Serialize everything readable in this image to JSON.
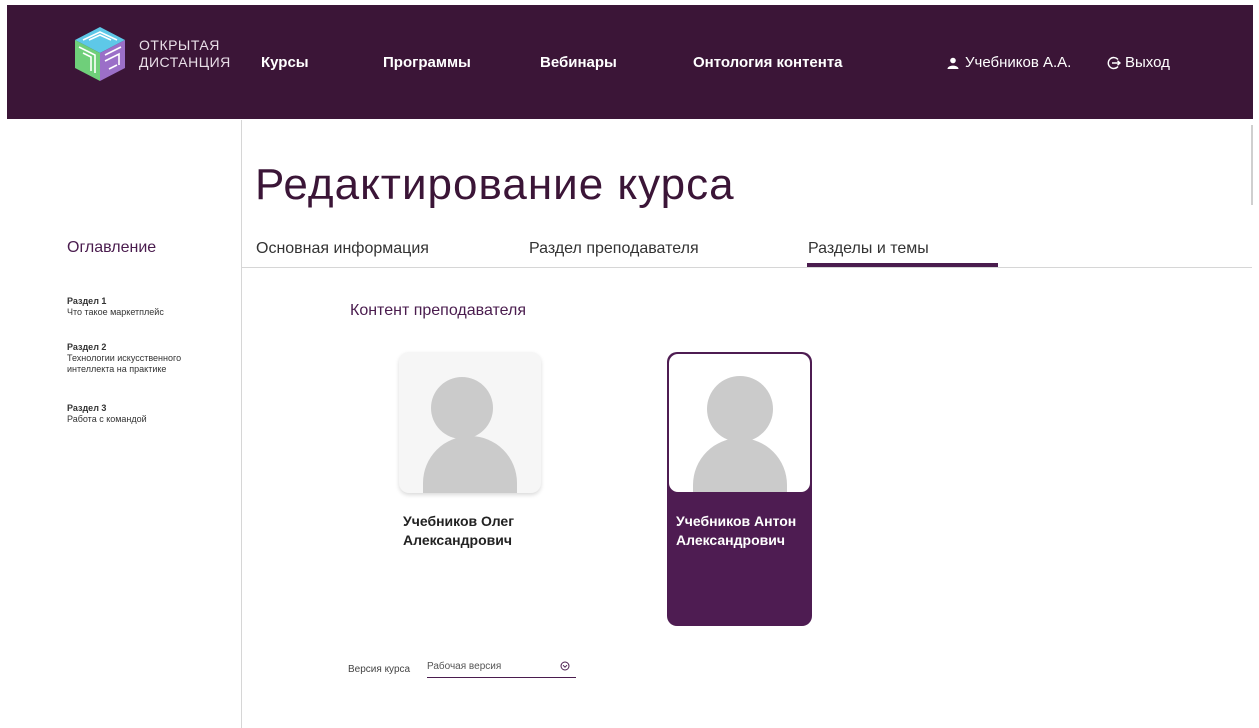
{
  "brand": {
    "line1": "ОТКРЫТАЯ",
    "line2": "ДИСТАНЦИЯ"
  },
  "nav": {
    "courses": "Курсы",
    "programs": "Программы",
    "webinars": "Вебинары",
    "ontology": "Онтология контента"
  },
  "user": {
    "name": "Учебников А.А.",
    "logout": "Выход"
  },
  "page": {
    "title": "Редактирование курса"
  },
  "toc": {
    "title": "Оглавление",
    "items": [
      {
        "section": "Раздел 1",
        "name": "Что такое маркетплейс"
      },
      {
        "section": "Раздел 2",
        "name": "Технологии искусственного интеллекта на практике"
      },
      {
        "section": "Раздел 3",
        "name": "Работа с командой"
      }
    ]
  },
  "tabs": {
    "main_info": "Основная информация",
    "teacher_section": "Раздел преподавателя",
    "sections_topics": "Разделы и темы"
  },
  "content": {
    "title": "Контент преподавателя",
    "teachers": [
      {
        "name_line1": "Учебников Олег",
        "name_line2": "Александрович"
      },
      {
        "name_line1": "Учебников Антон",
        "name_line2": "Александрович"
      }
    ]
  },
  "version": {
    "label": "Версия курса",
    "value": "Рабочая версия"
  },
  "colors": {
    "header_bg": "#3b1537",
    "accent": "#4e1c52"
  }
}
